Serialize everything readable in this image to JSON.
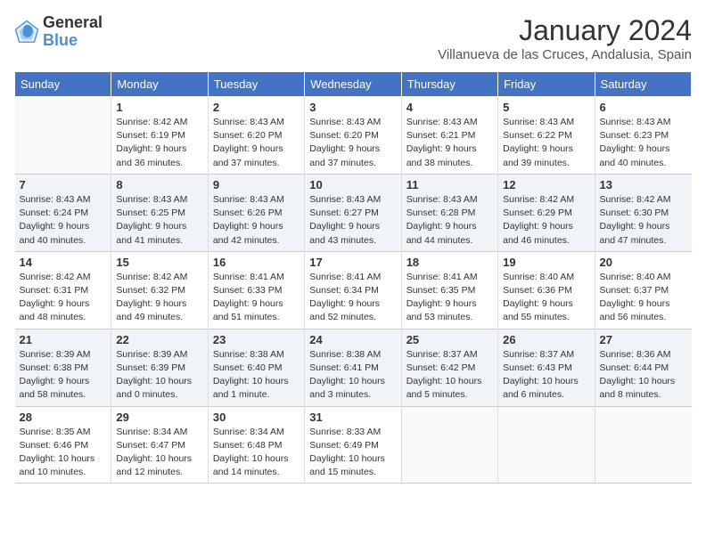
{
  "header": {
    "logo_line1": "General",
    "logo_line2": "Blue",
    "title": "January 2024",
    "subtitle": "Villanueva de las Cruces, Andalusia, Spain"
  },
  "days_of_week": [
    "Sunday",
    "Monday",
    "Tuesday",
    "Wednesday",
    "Thursday",
    "Friday",
    "Saturday"
  ],
  "weeks": [
    [
      {
        "day": "",
        "info": ""
      },
      {
        "day": "1",
        "info": "Sunrise: 8:42 AM\nSunset: 6:19 PM\nDaylight: 9 hours\nand 36 minutes."
      },
      {
        "day": "2",
        "info": "Sunrise: 8:43 AM\nSunset: 6:20 PM\nDaylight: 9 hours\nand 37 minutes."
      },
      {
        "day": "3",
        "info": "Sunrise: 8:43 AM\nSunset: 6:20 PM\nDaylight: 9 hours\nand 37 minutes."
      },
      {
        "day": "4",
        "info": "Sunrise: 8:43 AM\nSunset: 6:21 PM\nDaylight: 9 hours\nand 38 minutes."
      },
      {
        "day": "5",
        "info": "Sunrise: 8:43 AM\nSunset: 6:22 PM\nDaylight: 9 hours\nand 39 minutes."
      },
      {
        "day": "6",
        "info": "Sunrise: 8:43 AM\nSunset: 6:23 PM\nDaylight: 9 hours\nand 40 minutes."
      }
    ],
    [
      {
        "day": "7",
        "info": "Sunrise: 8:43 AM\nSunset: 6:24 PM\nDaylight: 9 hours\nand 40 minutes."
      },
      {
        "day": "8",
        "info": "Sunrise: 8:43 AM\nSunset: 6:25 PM\nDaylight: 9 hours\nand 41 minutes."
      },
      {
        "day": "9",
        "info": "Sunrise: 8:43 AM\nSunset: 6:26 PM\nDaylight: 9 hours\nand 42 minutes."
      },
      {
        "day": "10",
        "info": "Sunrise: 8:43 AM\nSunset: 6:27 PM\nDaylight: 9 hours\nand 43 minutes."
      },
      {
        "day": "11",
        "info": "Sunrise: 8:43 AM\nSunset: 6:28 PM\nDaylight: 9 hours\nand 44 minutes."
      },
      {
        "day": "12",
        "info": "Sunrise: 8:42 AM\nSunset: 6:29 PM\nDaylight: 9 hours\nand 46 minutes."
      },
      {
        "day": "13",
        "info": "Sunrise: 8:42 AM\nSunset: 6:30 PM\nDaylight: 9 hours\nand 47 minutes."
      }
    ],
    [
      {
        "day": "14",
        "info": "Sunrise: 8:42 AM\nSunset: 6:31 PM\nDaylight: 9 hours\nand 48 minutes."
      },
      {
        "day": "15",
        "info": "Sunrise: 8:42 AM\nSunset: 6:32 PM\nDaylight: 9 hours\nand 49 minutes."
      },
      {
        "day": "16",
        "info": "Sunrise: 8:41 AM\nSunset: 6:33 PM\nDaylight: 9 hours\nand 51 minutes."
      },
      {
        "day": "17",
        "info": "Sunrise: 8:41 AM\nSunset: 6:34 PM\nDaylight: 9 hours\nand 52 minutes."
      },
      {
        "day": "18",
        "info": "Sunrise: 8:41 AM\nSunset: 6:35 PM\nDaylight: 9 hours\nand 53 minutes."
      },
      {
        "day": "19",
        "info": "Sunrise: 8:40 AM\nSunset: 6:36 PM\nDaylight: 9 hours\nand 55 minutes."
      },
      {
        "day": "20",
        "info": "Sunrise: 8:40 AM\nSunset: 6:37 PM\nDaylight: 9 hours\nand 56 minutes."
      }
    ],
    [
      {
        "day": "21",
        "info": "Sunrise: 8:39 AM\nSunset: 6:38 PM\nDaylight: 9 hours\nand 58 minutes."
      },
      {
        "day": "22",
        "info": "Sunrise: 8:39 AM\nSunset: 6:39 PM\nDaylight: 10 hours\nand 0 minutes."
      },
      {
        "day": "23",
        "info": "Sunrise: 8:38 AM\nSunset: 6:40 PM\nDaylight: 10 hours\nand 1 minute."
      },
      {
        "day": "24",
        "info": "Sunrise: 8:38 AM\nSunset: 6:41 PM\nDaylight: 10 hours\nand 3 minutes."
      },
      {
        "day": "25",
        "info": "Sunrise: 8:37 AM\nSunset: 6:42 PM\nDaylight: 10 hours\nand 5 minutes."
      },
      {
        "day": "26",
        "info": "Sunrise: 8:37 AM\nSunset: 6:43 PM\nDaylight: 10 hours\nand 6 minutes."
      },
      {
        "day": "27",
        "info": "Sunrise: 8:36 AM\nSunset: 6:44 PM\nDaylight: 10 hours\nand 8 minutes."
      }
    ],
    [
      {
        "day": "28",
        "info": "Sunrise: 8:35 AM\nSunset: 6:46 PM\nDaylight: 10 hours\nand 10 minutes."
      },
      {
        "day": "29",
        "info": "Sunrise: 8:34 AM\nSunset: 6:47 PM\nDaylight: 10 hours\nand 12 minutes."
      },
      {
        "day": "30",
        "info": "Sunrise: 8:34 AM\nSunset: 6:48 PM\nDaylight: 10 hours\nand 14 minutes."
      },
      {
        "day": "31",
        "info": "Sunrise: 8:33 AM\nSunset: 6:49 PM\nDaylight: 10 hours\nand 15 minutes."
      },
      {
        "day": "",
        "info": ""
      },
      {
        "day": "",
        "info": ""
      },
      {
        "day": "",
        "info": ""
      }
    ]
  ]
}
